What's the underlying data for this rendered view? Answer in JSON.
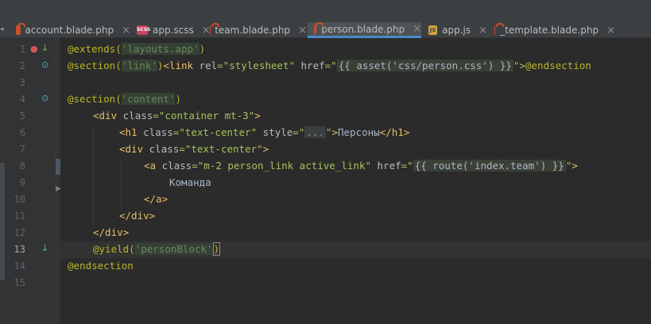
{
  "tabs": [
    {
      "label": "account.blade.php",
      "icon": "blade-file-icon",
      "active": false
    },
    {
      "label": "app.scss",
      "icon": "scss-file-icon",
      "icon_text": "SCSS",
      "active": false
    },
    {
      "label": "team.blade.php",
      "icon": "blade-file-icon",
      "active": false
    },
    {
      "label": "person.blade.php",
      "icon": "blade-file-icon",
      "active": true
    },
    {
      "label": "app.js",
      "icon": "js-file-icon",
      "icon_text": "JS",
      "active": false
    },
    {
      "label": "_template.blade.php",
      "icon": "blade-file-icon",
      "active": false
    }
  ],
  "close_glyph": "×",
  "line_numbers": [
    "1",
    "2",
    "3",
    "4",
    "5",
    "6",
    "7",
    "8",
    "9",
    "10",
    "11",
    "12",
    "13",
    "14",
    "15"
  ],
  "current_line": "13",
  "code": {
    "l1": {
      "d": "@extends(",
      "s": "'layouts.app'",
      "e": ")"
    },
    "l2": {
      "d": "@section(",
      "s": "'link'",
      "e": ")",
      "t1": "<link ",
      "a1": "rel",
      "v1": "=\"stylesheet\" ",
      "a2": "href",
      "v2": "=\"",
      "b": "{{ asset('css/person.css') }}",
      "v3": "\">",
      "d2": "@endsection"
    },
    "l4": {
      "d": "@section(",
      "s": "'content'",
      "e": ")"
    },
    "l5": {
      "t": "<div ",
      "a": "class",
      "v": "=\"container mt-3\"",
      "t2": ">"
    },
    "l6": {
      "t": "<h1 ",
      "a": "class",
      "v": "=\"text-center\" ",
      "a2": "style",
      "v2": "=\"",
      "f": "...",
      "v3": "\"",
      "t2": ">",
      "txt": "Персоны",
      "t3": "</h1>"
    },
    "l7": {
      "t": "<div ",
      "a": "class",
      "v": "=\"text-center\"",
      "t2": ">"
    },
    "l8": {
      "t": "<a ",
      "a": "class",
      "v": "=\"m-2 person_link active_link\" ",
      "a2": "href",
      "v2": "=\"",
      "b": "{{ route('index.team') }}",
      "v3": "\"",
      "t2": ">"
    },
    "l9": {
      "txt": "Команда"
    },
    "l10": {
      "t": "</a>"
    },
    "l11": {
      "t": "</div>"
    },
    "l12": {
      "t": "</div>"
    },
    "l13": {
      "d": "@yield(",
      "s": "'personBlock'",
      "e": ")"
    },
    "l14": {
      "d": "@endsection"
    }
  },
  "colors": {
    "background": "#2b2b2b",
    "directive": "#bbb529",
    "string": "#6a8759",
    "tag": "#e8bf6a",
    "text": "#a9b7c6",
    "active_tab_underline": "#4a88c7"
  }
}
